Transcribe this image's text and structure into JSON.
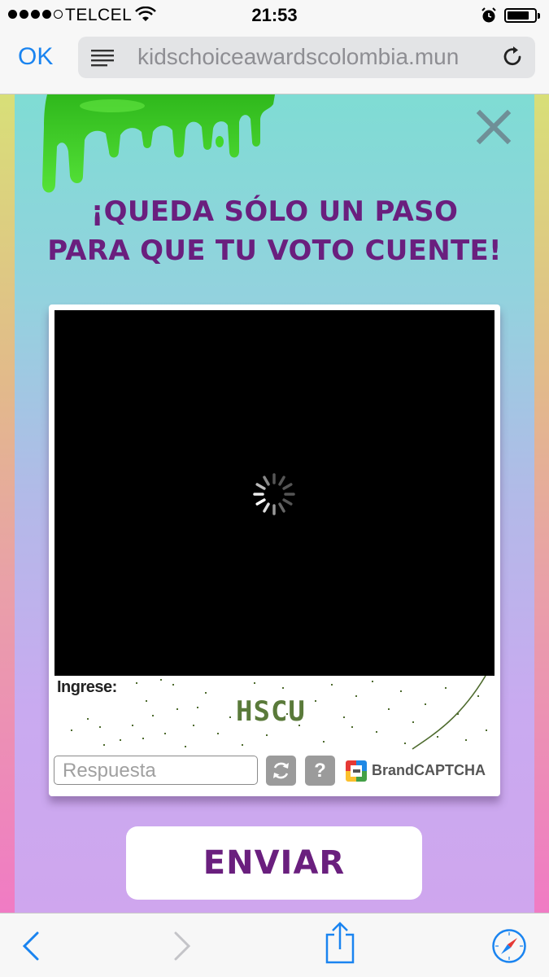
{
  "status_bar": {
    "carrier": "TELCEL",
    "time": "21:53",
    "battery_level": 0.75
  },
  "browser": {
    "done_label": "OK",
    "url": "kidschoiceawardscolombia.mun",
    "icons": [
      "reader-icon",
      "reload-icon",
      "back-icon",
      "forward-icon",
      "share-icon",
      "compass-icon"
    ]
  },
  "popup": {
    "headline_line1": "¡QUEDA SÓLO UN PASO",
    "headline_line2": "PARA QUE TU VOTO CUENTE!",
    "close_icon": "close-icon"
  },
  "captcha": {
    "prompt_label": "Ingrese:",
    "code": "HSCU",
    "answer_placeholder": "Respuesta",
    "help_label": "?",
    "brand": "BrandCAPTCHA"
  },
  "submit_label": "ENVIAR",
  "colors": {
    "accent_purple": "#6a1f7e",
    "ios_blue": "#1a84f0",
    "slime_green": "#3fd22a"
  }
}
